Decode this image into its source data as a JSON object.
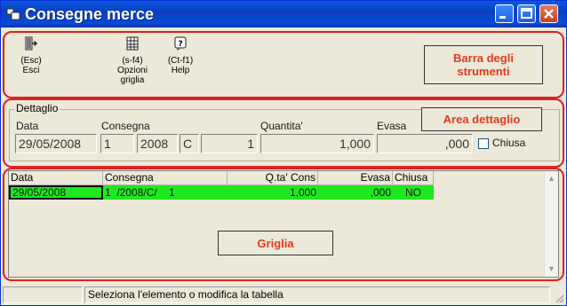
{
  "window": {
    "title": "Consegne merce"
  },
  "toolbar": {
    "items": [
      {
        "key": "(Esc)",
        "label": "Esci",
        "icon": "exit-icon"
      },
      {
        "key": "(s-f4)",
        "label": "Opzioni griglia",
        "icon": "grid-options-icon"
      },
      {
        "key": "(Ct-f1)",
        "label": "Help",
        "icon": "help-icon"
      }
    ],
    "annotation": "Barra degli strumenti"
  },
  "detail": {
    "legend": "Dettaglio",
    "annotation": "Area dettaglio",
    "labels": {
      "data": "Data",
      "consegna": "Consegna",
      "quantita": "Quantita'",
      "evasa": "Evasa",
      "chiusa": "Chiusa"
    },
    "fields": {
      "data": "29/05/2008",
      "consegna_num": "1",
      "consegna_anno": "2008",
      "consegna_tipo": "C",
      "consegna_riga": "1",
      "quantita": "1,000",
      "evasa": ",000"
    }
  },
  "grid": {
    "annotation": "Griglia",
    "columns": [
      "Data",
      "Consegna",
      "Q.ta' Cons",
      "Evasa",
      "Chiusa"
    ],
    "rows": [
      {
        "data": "29/05/2008",
        "consegna": "1  /2008/C/    1",
        "qta": "1,000",
        "evasa": ",000",
        "chiusa": "NO"
      }
    ],
    "row_color": "#1ee81e"
  },
  "status": {
    "message": "Seleziona l'elemento o modifica la tabella"
  },
  "colors": {
    "title_bar": "#0a4ad6",
    "annotation_text": "#e03c1c",
    "highlight_frame": "#e02020"
  }
}
